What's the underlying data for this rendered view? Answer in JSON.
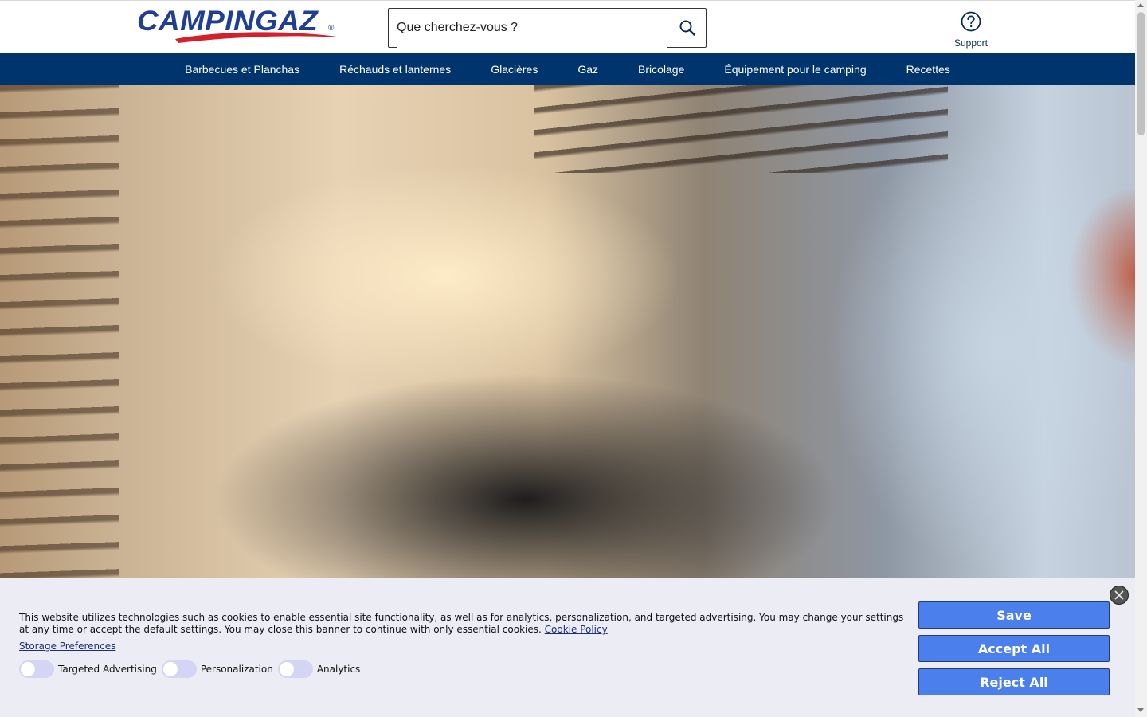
{
  "header": {
    "logo_text": "CAMPINGAZ",
    "logo_reg": "®",
    "search": {
      "placeholder": "Que cherchez-vous ?"
    },
    "support_label": "Support"
  },
  "nav": {
    "items": [
      {
        "label": "Barbecues et Planchas"
      },
      {
        "label": "Réchauds et lanternes"
      },
      {
        "label": "Glacières"
      },
      {
        "label": "Gaz"
      },
      {
        "label": "Bricolage"
      },
      {
        "label": "Équipement pour le camping"
      },
      {
        "label": "Recettes"
      }
    ]
  },
  "cookie_banner": {
    "text": "This website utilizes technologies such as cookies to enable essential site functionality, as well as for analytics, personalization, and targeted advertising. You may change your settings at any time or accept the default settings. You may close this banner to continue with only essential cookies.",
    "cookie_policy_link": "Cookie Policy",
    "storage_preferences_link": "Storage Preferences",
    "toggles": [
      {
        "label": "Targeted Advertising",
        "on": false
      },
      {
        "label": "Personalization",
        "on": false
      },
      {
        "label": "Analytics",
        "on": false
      }
    ],
    "buttons": {
      "save": "Save",
      "accept_all": "Accept All",
      "reject_all": "Reject All"
    }
  },
  "colors": {
    "brand_blue": "#1f3f96",
    "brand_red": "#d4202a",
    "nav_background": "#00346d",
    "button_blue": "#4a7fec",
    "banner_background": "#ececf4"
  },
  "icons": {
    "search": "search-icon",
    "support": "question-circle-icon",
    "close": "close-icon"
  }
}
